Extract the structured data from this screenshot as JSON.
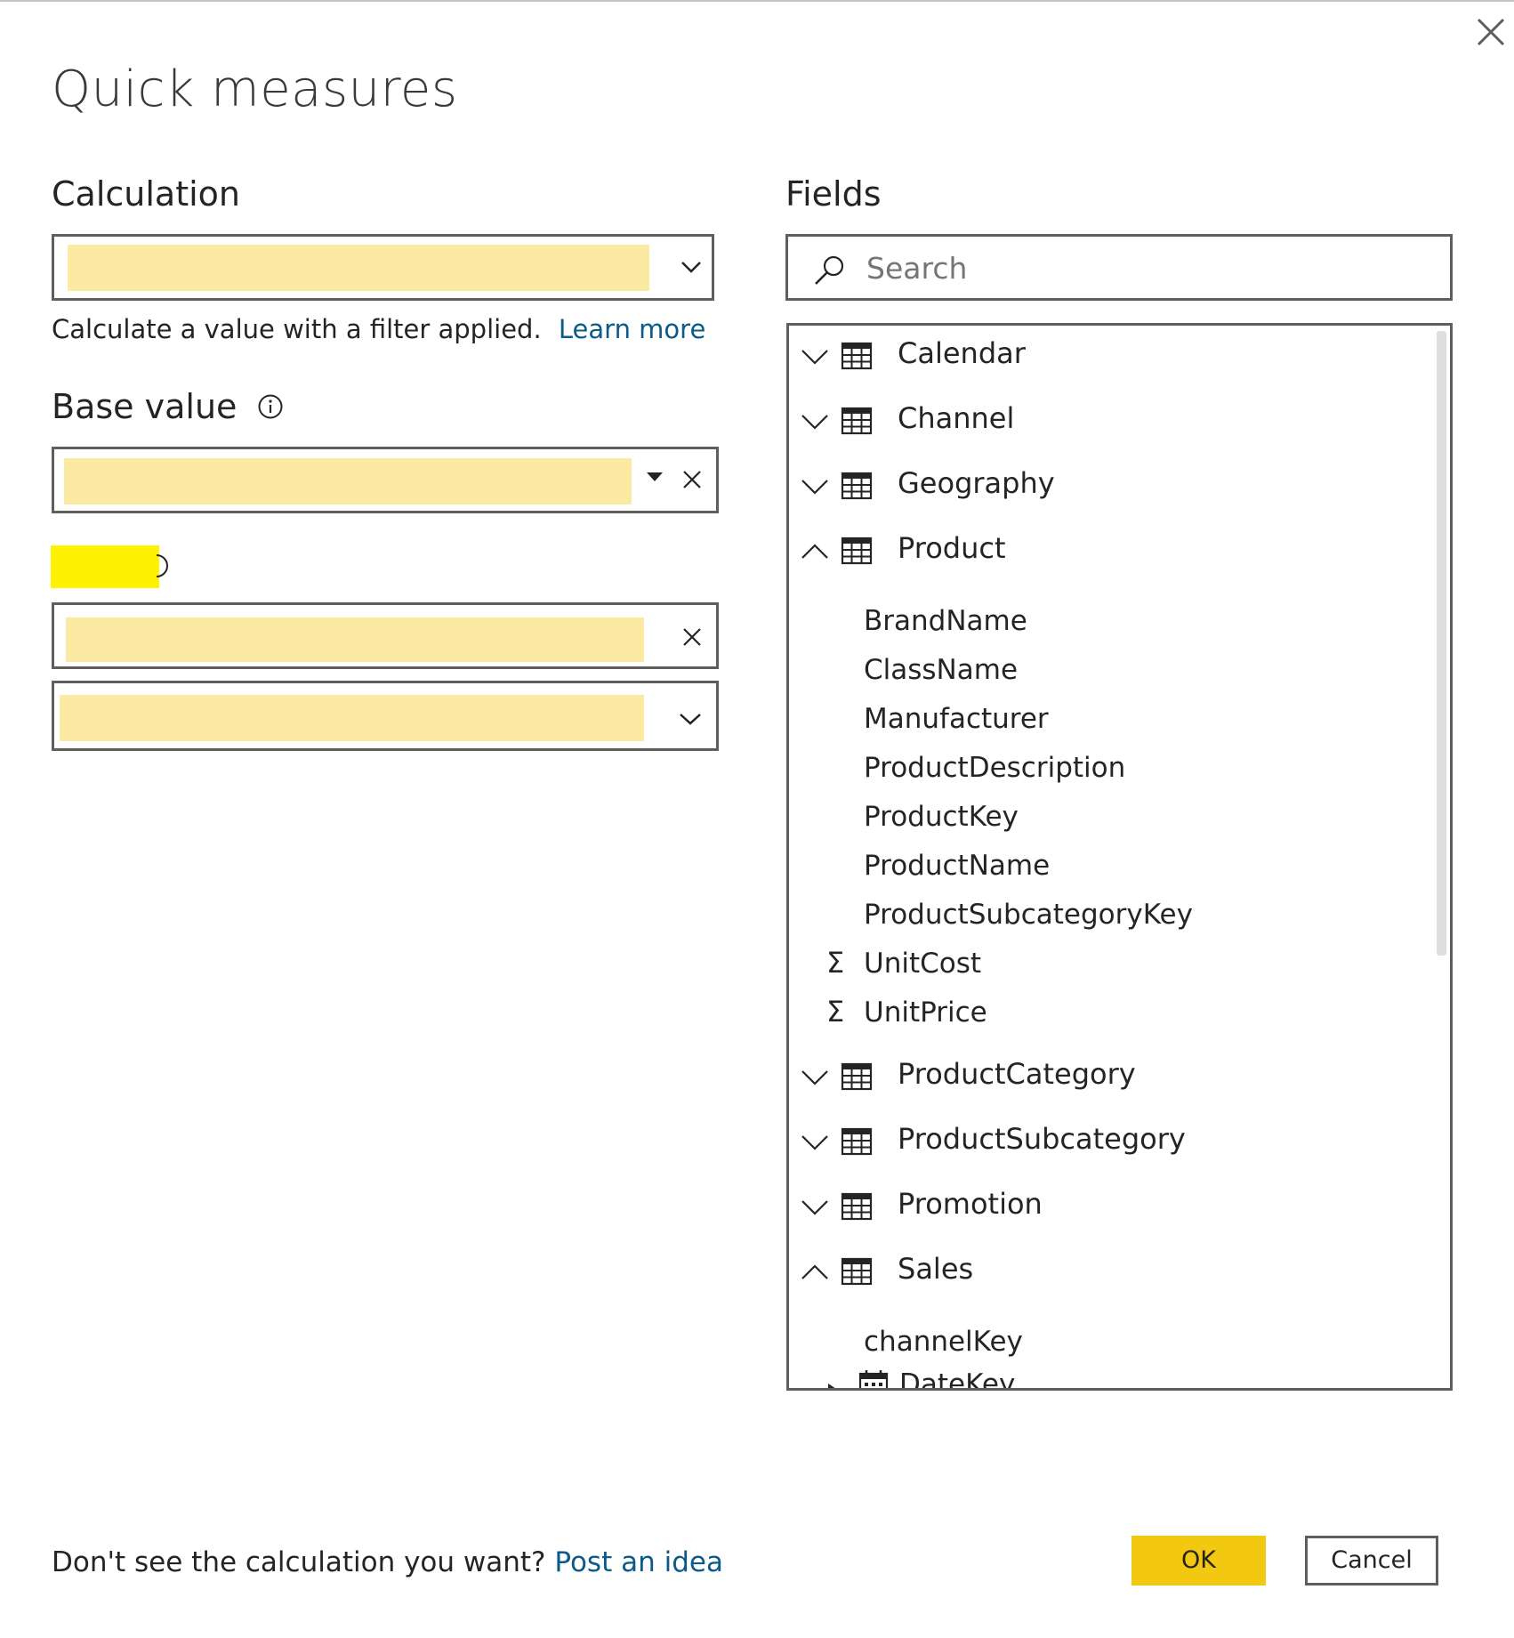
{
  "dialog": {
    "title": "Quick measures",
    "close_icon": "close-icon"
  },
  "calculation": {
    "label": "Calculation",
    "selected_value": "",
    "description": "Calculate a value with a filter applied.",
    "learn_more": "Learn more"
  },
  "base_value": {
    "label": "Base value",
    "info_icon": "info-icon",
    "value": ""
  },
  "filter": {
    "label": "",
    "value": "",
    "dropdown_value": ""
  },
  "fields": {
    "label": "Fields",
    "search_placeholder": "Search",
    "tables": [
      {
        "name": "Calendar",
        "expanded": false
      },
      {
        "name": "Channel",
        "expanded": false
      },
      {
        "name": "Geography",
        "expanded": false
      },
      {
        "name": "Product",
        "expanded": true
      },
      {
        "name": "ProductCategory",
        "expanded": false
      },
      {
        "name": "ProductSubcategory",
        "expanded": false
      },
      {
        "name": "Promotion",
        "expanded": false
      },
      {
        "name": "Sales",
        "expanded": true
      }
    ],
    "product_fields": [
      {
        "name": "BrandName",
        "icon": ""
      },
      {
        "name": "ClassName",
        "icon": ""
      },
      {
        "name": "Manufacturer",
        "icon": ""
      },
      {
        "name": "ProductDescription",
        "icon": ""
      },
      {
        "name": "ProductKey",
        "icon": ""
      },
      {
        "name": "ProductName",
        "icon": ""
      },
      {
        "name": "ProductSubcategoryKey",
        "icon": ""
      },
      {
        "name": "UnitCost",
        "icon": "sigma-icon"
      },
      {
        "name": "UnitPrice",
        "icon": "sigma-icon"
      }
    ],
    "sales_fields": [
      {
        "name": "channelKey",
        "icon": ""
      },
      {
        "name": "DateKey",
        "icon": "calendar-icon"
      }
    ]
  },
  "footer": {
    "prompt": "Don't see the calculation you want?",
    "post_idea": "Post an idea",
    "ok_label": "OK",
    "cancel_label": "Cancel"
  },
  "colors": {
    "accent": "#f2c811",
    "redaction": "#fce9a2",
    "redaction_strong": "#fff200",
    "link": "#0b5a8a"
  }
}
